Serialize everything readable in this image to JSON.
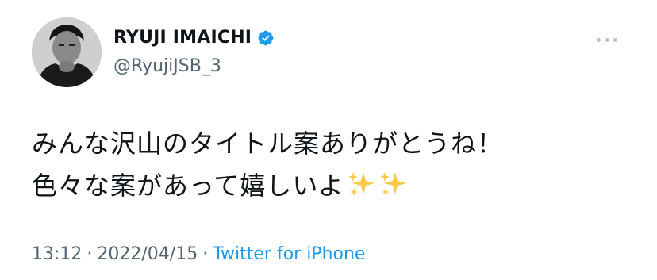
{
  "tweet": {
    "author": {
      "display_name": "RYUJI IMAICHI",
      "handle": "@RyujiJSB_3",
      "verified": true
    },
    "text_lines": [
      "みんな沢山のタイトル案ありがとうね！",
      "色々な案があって嬉しいよ"
    ],
    "emoji": [
      "sparkles-icon",
      "sparkles-icon"
    ],
    "time": "13:12",
    "separator": "·",
    "date": "2022/04/15",
    "source": "Twitter for iPhone"
  },
  "colors": {
    "text": "#0f1419",
    "secondary": "#536471",
    "link": "#1d9bf0",
    "verified_badge": "#1d9bf0",
    "sparkle": "#f7c948"
  }
}
